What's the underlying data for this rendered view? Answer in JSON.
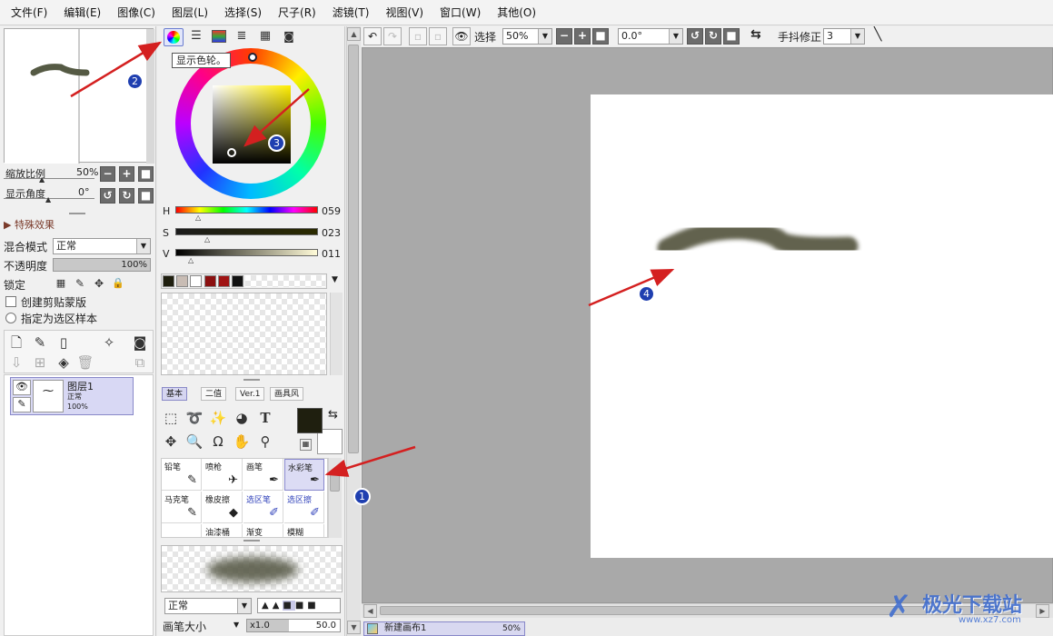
{
  "menu": [
    "文件(F)",
    "编辑(E)",
    "图像(C)",
    "图层(L)",
    "选择(S)",
    "尺子(R)",
    "滤镜(T)",
    "视图(V)",
    "窗口(W)",
    "其他(O)"
  ],
  "navigator": {
    "zoom_label": "缩放比例",
    "zoom_value": "50%",
    "angle_label": "显示角度",
    "angle_value": "0°"
  },
  "effects": {
    "label": "特殊效果"
  },
  "layer_props": {
    "blend_label": "混合模式",
    "blend_value": "正常",
    "opacity_label": "不透明度",
    "opacity_value": "100%",
    "lock_label": "锁定",
    "clip_label": "创建剪贴蒙版",
    "sample_label": "指定为选区样本"
  },
  "layer": {
    "name": "图层1",
    "mode": "正常",
    "opacity": "100%"
  },
  "color": {
    "tooltip": "显示色轮。",
    "h_label": "H",
    "h_value": "059",
    "s_label": "S",
    "s_value": "023",
    "v_label": "V",
    "v_value": "011",
    "main_color": "#1f1f0f",
    "swatches": [
      "#1f1f0f",
      "#c8bcb4",
      "#ffffff",
      "#8b1010",
      "#a01414",
      "#111111"
    ]
  },
  "tool_tabs": [
    "基本",
    "二值",
    "Ver.1",
    "画具风"
  ],
  "brushes": [
    {
      "label": "铅笔",
      "icon": "pencil-icon",
      "glyph": "✎"
    },
    {
      "label": "喷枪",
      "icon": "airbrush-icon",
      "glyph": "✈"
    },
    {
      "label": "画笔",
      "icon": "brush-icon",
      "glyph": "🖌"
    },
    {
      "label": "水彩笔",
      "icon": "watercolor-brush-icon",
      "glyph": "🖌"
    },
    {
      "label": "马克笔",
      "icon": "marker-icon",
      "glyph": "✎"
    },
    {
      "label": "橡皮擦",
      "icon": "eraser-icon",
      "glyph": "◆"
    },
    {
      "label": "选区笔",
      "icon": "selection-pen-icon",
      "glyph": "✐"
    },
    {
      "label": "选区擦",
      "icon": "selection-eraser-icon",
      "glyph": "✐"
    },
    {
      "label": "",
      "icon": "",
      "glyph": ""
    },
    {
      "label": "油漆桶",
      "icon": "bucket-icon",
      "glyph": ""
    },
    {
      "label": "渐变",
      "icon": "gradient-icon",
      "glyph": ""
    },
    {
      "label": "模糊",
      "icon": "blur-icon",
      "glyph": ""
    }
  ],
  "brush_settings": {
    "mode": "正常",
    "size_label": "画笔大小",
    "size_mult": "x1.0",
    "size_value": "50.0"
  },
  "toolbar": {
    "select_label": "选择",
    "zoom": "50%",
    "angle": "0.0°",
    "stabilizer_label": "手抖修正",
    "stabilizer_value": "3"
  },
  "canvas_tab": {
    "name": "新建画布1",
    "zoom": "50%"
  },
  "annotations": [
    "1",
    "2",
    "3",
    "4"
  ],
  "watermark": {
    "text": "极光下载站",
    "url": "www.xz7.com"
  }
}
